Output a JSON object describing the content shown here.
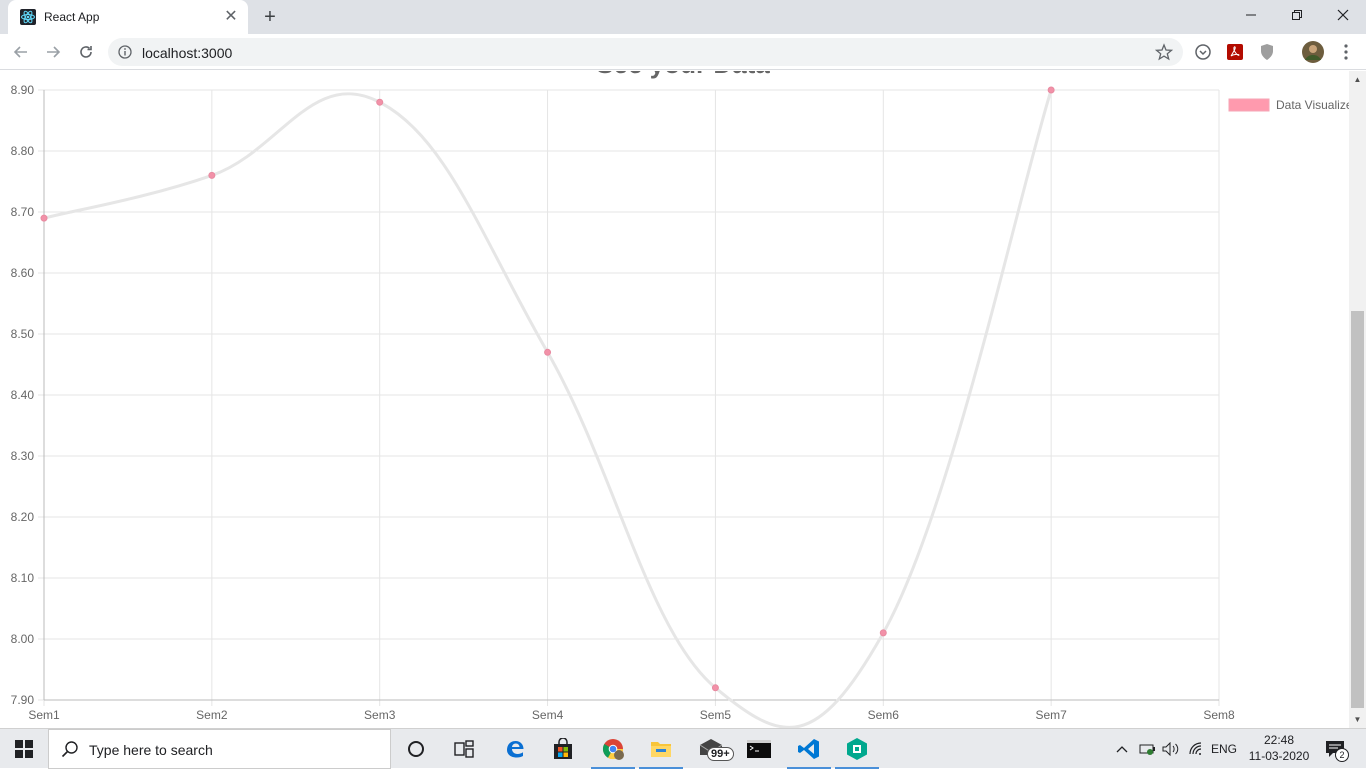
{
  "browser": {
    "tab_title": "React App",
    "url": "localhost:3000"
  },
  "page": {
    "heading_partial": "See your Data"
  },
  "chart_data": {
    "type": "line",
    "categories": [
      "Sem1",
      "Sem2",
      "Sem3",
      "Sem4",
      "Sem5",
      "Sem6",
      "Sem7",
      "Sem8"
    ],
    "series": [
      {
        "name": "Data Visualize",
        "values": [
          8.69,
          8.76,
          8.88,
          8.47,
          7.92,
          8.01,
          8.9
        ]
      }
    ],
    "y_ticks": [
      "8.90",
      "8.80",
      "8.70",
      "8.60",
      "8.50",
      "8.40",
      "8.30",
      "8.20",
      "8.10",
      "8.00",
      "7.90"
    ],
    "ylim": [
      7.9,
      8.9
    ],
    "grid": true,
    "legend": "top-right",
    "line_color": "#e6e6e6",
    "point_color": "#f291a8",
    "legend_color": "#ff9aae"
  },
  "taskbar": {
    "search_placeholder": "Type here to search",
    "mail_badge": "99+",
    "language": "ENG",
    "time": "22:48",
    "date": "11-03-2020",
    "notification_count": "2"
  }
}
